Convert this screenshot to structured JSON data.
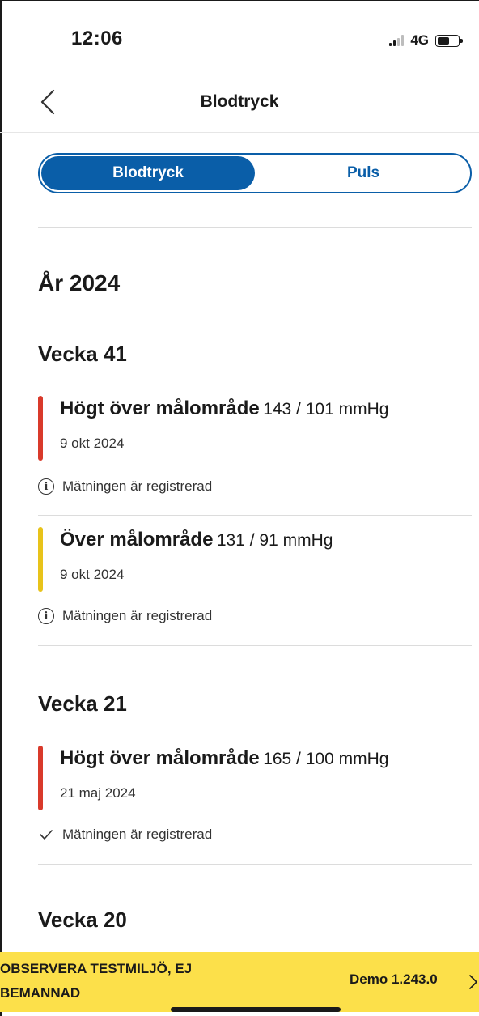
{
  "status_bar": {
    "time": "12:06",
    "network": "4G"
  },
  "nav": {
    "title": "Blodtryck"
  },
  "tabs": [
    {
      "label": "Blodtryck",
      "active": true
    },
    {
      "label": "Puls",
      "active": false
    }
  ],
  "year_heading": "År 2024",
  "weeks": [
    {
      "heading": "Vecka 41",
      "measurements": [
        {
          "level": "Högt över målområde",
          "value": "143 / 101 mmHg",
          "date": "9 okt 2024",
          "status": "Mätningen är registrerad",
          "status_icon": "info-icon",
          "color": "#d93a2b"
        },
        {
          "level": "Över målområde",
          "value": "131 / 91 mmHg",
          "date": "9 okt 2024",
          "status": "Mätningen är registrerad",
          "status_icon": "info-icon",
          "color": "#e8c31a"
        }
      ]
    },
    {
      "heading": "Vecka 21",
      "measurements": [
        {
          "level": "Högt över målområde",
          "value": "165 / 100 mmHg",
          "date": "21 maj 2024",
          "status": "Mätningen är registrerad",
          "status_icon": "check-icon",
          "color": "#d93a2b"
        }
      ]
    },
    {
      "heading": "Vecka 20",
      "measurements": []
    }
  ],
  "banner": {
    "line1": "OBSERVERA TESTMILJÖ, EJ",
    "line2": "BEMANNAD",
    "version": "Demo 1.243.0"
  },
  "colors": {
    "primary": "#0a5ea8",
    "high": "#d93a2b",
    "over": "#e8c31a",
    "banner": "#fce04a"
  }
}
